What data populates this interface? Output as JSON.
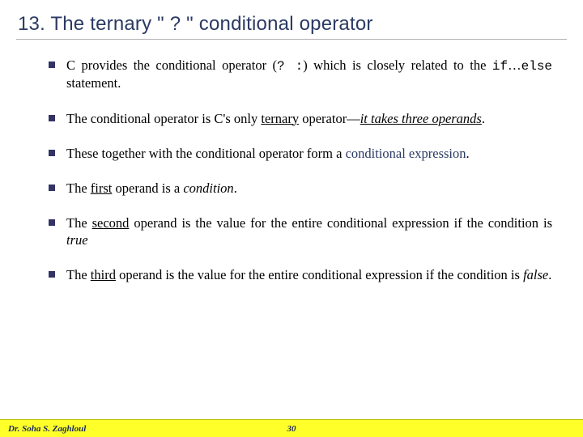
{
  "heading": "13.  The ternary \" ? \" conditional operator",
  "b1_a": "C provides the conditional operator (",
  "b1_b": "? :",
  "b1_c": ") which is closely related to the ",
  "b1_d": "if",
  "b1_e": "…",
  "b1_f": "else",
  "b1_g": " statement.",
  "b2_a": "The conditional operator is C's only ",
  "b2_b": "ternary",
  "b2_c": " operator—",
  "b2_d": "it takes three operands",
  "b2_e": ".",
  "b3_a": "These together with the conditional operator form a ",
  "b3_b": "conditional expression",
  "b3_c": ".",
  "b4_a": "The ",
  "b4_b": "first",
  "b4_c": " operand is a ",
  "b4_d": "condition",
  "b4_e": ".",
  "b5_a": "The ",
  "b5_b": "second",
  "b5_c": " operand is the value for the entire conditional expression if the condition is ",
  "b5_d": "true",
  "b6_a": "The ",
  "b6_b": "third",
  "b6_c": " operand is the value for the entire conditional expression if the condition is ",
  "b6_d": "false",
  "b6_e": ".",
  "footer_author": "Dr. Soha S. Zaghloul",
  "footer_page": "30"
}
